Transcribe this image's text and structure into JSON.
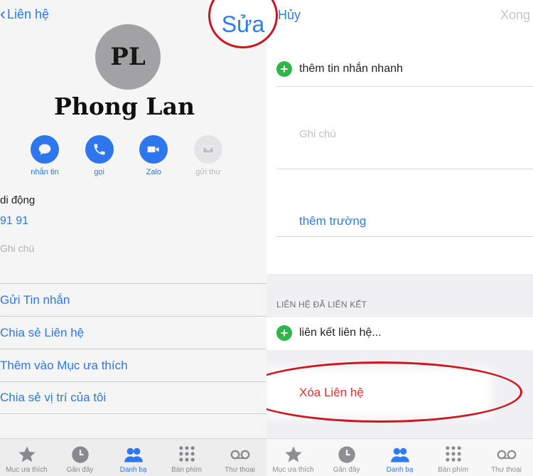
{
  "left": {
    "back_label": "Liên hệ",
    "edit_label": "Sửa",
    "avatar_initials": "PL",
    "contact_name": "Phong Lan",
    "actions": [
      {
        "label": "nhắn tin",
        "icon": "message-icon"
      },
      {
        "label": "gọi",
        "icon": "phone-icon"
      },
      {
        "label": "Zalo",
        "icon": "video-icon"
      },
      {
        "label": "gửi thư",
        "icon": "mail-icon"
      }
    ],
    "phone_label": "di động",
    "phone_value": "91 91",
    "note_label": "Ghi chú",
    "rows": [
      "Gửi Tin nhắn",
      "Chia sẻ Liên hệ",
      "Thêm vào Mục ưa thích",
      "Chia sẻ vị trí của tôi"
    ]
  },
  "right": {
    "cancel_label": "Hủy",
    "done_label": "Xong",
    "add_quick_message": "thêm tin nhắn nhanh",
    "note_placeholder": "Ghi chú",
    "add_field": "thêm trường",
    "linked_section_title": "LIÊN HỆ ĐÃ LIÊN KẾT",
    "link_contact": "liên kết liên hệ...",
    "delete_contact": "Xóa Liên hệ"
  },
  "tabbar": [
    {
      "label": "Mục ưa thích",
      "icon": "star-icon",
      "active": false
    },
    {
      "label": "Gần đây",
      "icon": "clock-icon",
      "active": false
    },
    {
      "label": "Danh bạ",
      "icon": "contacts-icon",
      "active": true
    },
    {
      "label": "Bàn phím",
      "icon": "keypad-icon",
      "active": false
    },
    {
      "label": "Thư thoại",
      "icon": "voicemail-icon",
      "active": false
    }
  ],
  "colors": {
    "accent": "#2f7bf5",
    "destructive": "#e0332b",
    "highlight_ring": "#d0141c",
    "add_green": "#2fb64a"
  }
}
